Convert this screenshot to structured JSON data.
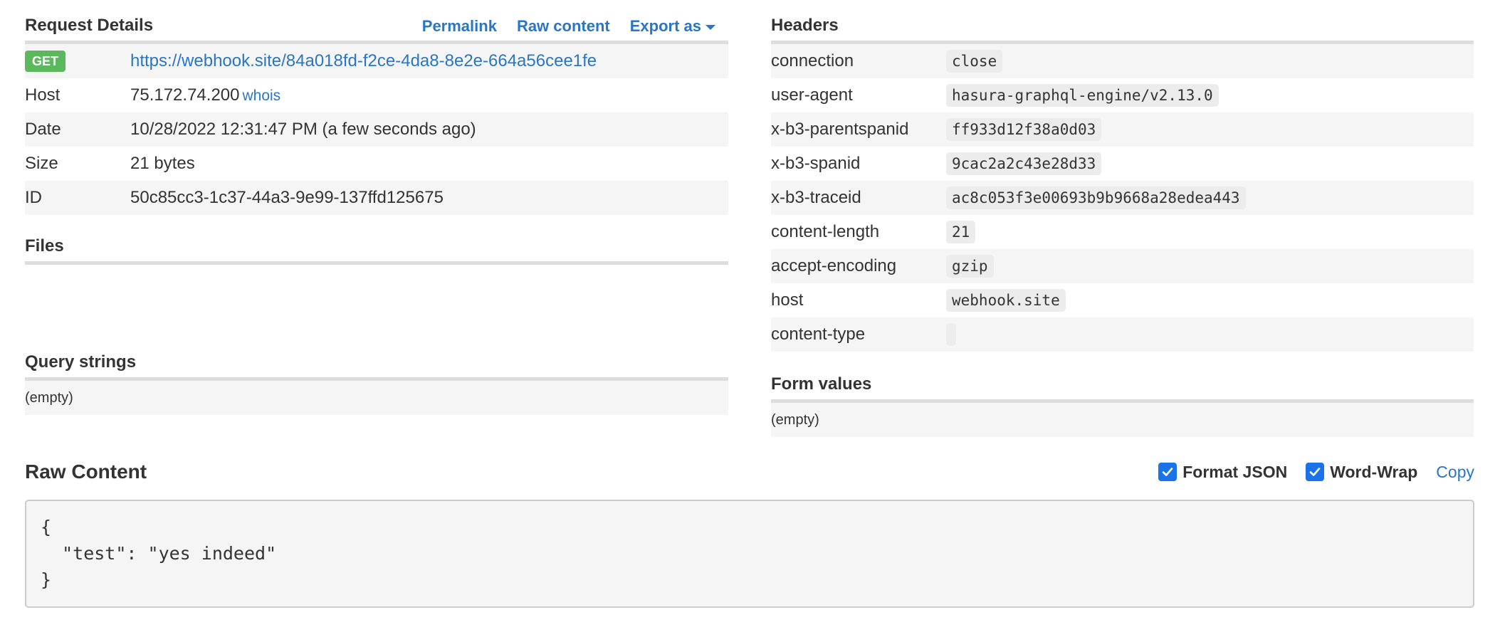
{
  "request_details": {
    "title": "Request Details",
    "links": {
      "permalink": "Permalink",
      "raw_content": "Raw content",
      "export_as": "Export as"
    },
    "method": "GET",
    "url": "https://webhook.site/84a018fd-f2ce-4da8-8e2e-664a56cee1fe",
    "host": {
      "label": "Host",
      "value": "75.172.74.200",
      "whois": "whois"
    },
    "date": {
      "label": "Date",
      "value": "10/28/2022 12:31:47 PM (a few seconds ago)"
    },
    "size": {
      "label": "Size",
      "value": "21 bytes"
    },
    "id": {
      "label": "ID",
      "value": "50c85cc3-1c37-44a3-9e99-137ffd125675"
    }
  },
  "files": {
    "title": "Files"
  },
  "headers": {
    "title": "Headers",
    "rows": [
      {
        "key": "connection",
        "value": "close"
      },
      {
        "key": "user-agent",
        "value": "hasura-graphql-engine/v2.13.0"
      },
      {
        "key": "x-b3-parentspanid",
        "value": "ff933d12f38a0d03"
      },
      {
        "key": "x-b3-spanid",
        "value": "9cac2a2c43e28d33"
      },
      {
        "key": "x-b3-traceid",
        "value": "ac8c053f3e00693b9b9668a28edea443"
      },
      {
        "key": "content-length",
        "value": "21"
      },
      {
        "key": "accept-encoding",
        "value": "gzip"
      },
      {
        "key": "host",
        "value": "webhook.site"
      },
      {
        "key": "content-type",
        "value": ""
      }
    ]
  },
  "query_strings": {
    "title": "Query strings",
    "empty_text": "(empty)"
  },
  "form_values": {
    "title": "Form values",
    "empty_text": "(empty)"
  },
  "raw_content": {
    "title": "Raw Content",
    "format_json": {
      "label": "Format JSON",
      "checked": true
    },
    "word_wrap": {
      "label": "Word-Wrap",
      "checked": true
    },
    "copy_label": "Copy",
    "body": "{\n  \"test\": \"yes indeed\"\n}"
  },
  "colors": {
    "link": "#2a76c6",
    "badge_get": "#5cb85c",
    "checkbox": "#1a73e8",
    "stripe": "#f5f5f5"
  }
}
